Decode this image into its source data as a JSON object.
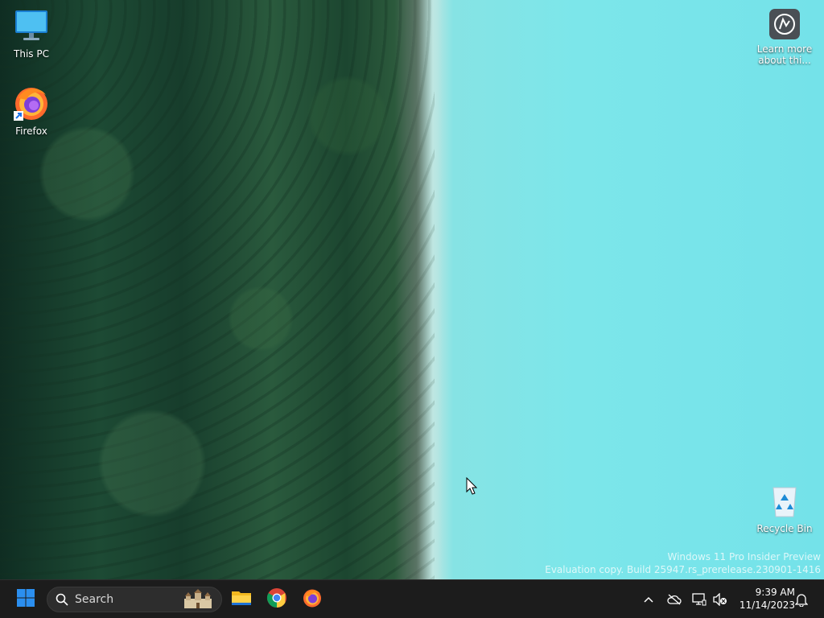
{
  "desktop": {
    "icons": [
      {
        "label": "This PC",
        "icon": "monitor-icon"
      },
      {
        "label": "Firefox",
        "icon": "firefox-icon"
      },
      {
        "label": "Learn more about thi...",
        "icon": "learn-more-icon"
      },
      {
        "label": "Recycle Bin",
        "icon": "recycle-bin-icon"
      }
    ],
    "watermark": {
      "line1": "Windows 11 Pro Insider Preview",
      "line2": "Evaluation copy. Build 25947.rs_prerelease.230901-1416"
    }
  },
  "taskbar": {
    "search_placeholder": "Search",
    "pinned": [
      {
        "name": "File Explorer",
        "icon": "folder-icon"
      },
      {
        "name": "Google Chrome",
        "icon": "chrome-icon"
      },
      {
        "name": "Firefox",
        "icon": "firefox-icon"
      }
    ],
    "tray": {
      "time": "9:39 AM",
      "date": "11/14/2023"
    }
  },
  "colors": {
    "taskbar_bg": "#1c1c1c",
    "start_blue": "#2b8ff0",
    "lake": "#7ce6ea",
    "forest": "#1d4a34"
  }
}
